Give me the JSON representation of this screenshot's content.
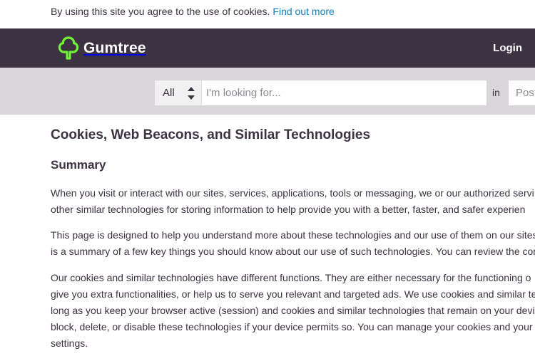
{
  "cookie_notice": {
    "text": "By using this site you agree to the use of cookies.",
    "link": "Find out more"
  },
  "header": {
    "brand": "Gumtree",
    "login": "Login",
    "logo_icon": "tree-icon",
    "background_color": "#3c3241",
    "accent_color": "#72ef36"
  },
  "search": {
    "category_value": "All",
    "placeholder": "I'm looking for...",
    "in_label": "in",
    "location_placeholder": "Postcode or location"
  },
  "article": {
    "title": "Cookies, Web Beacons, and Similar Technologies",
    "heading": "Summary",
    "paragraphs": [
      [
        "When you visit or interact with our sites, services, applications, tools or messaging, we or our authorized servi",
        "other similar technologies for storing information to help provide you with a better, faster, and safer experien"
      ],
      [
        "This page is designed to help you understand more about these technologies and our use of them on our sites",
        "is a summary of a few key things you should know about our use of such technologies. You can review the con"
      ],
      [
        "Our cookies and similar technologies have different functions. They are either necessary for the functioning o",
        "give you extra functionalities, or help us to serve you relevant and targeted ads. We use cookies and similar te",
        "long as you keep your browser active (session) and cookies and similar technologies that remain on your devi",
        "block, delete, or disable these technologies if your device permits so. You can manage your cookies and your",
        "settings."
      ]
    ]
  }
}
